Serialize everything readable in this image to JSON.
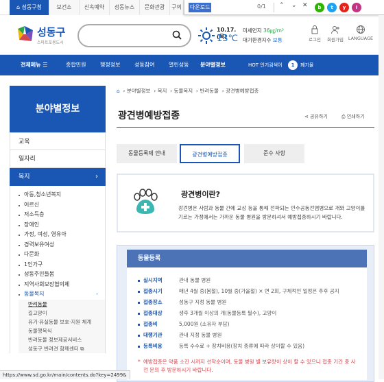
{
  "top_tabs": [
    "성동구청",
    "보건소",
    "신속예약",
    "성동뉴스",
    "문화관광",
    "구의"
  ],
  "find_bar": {
    "query": "다운로드",
    "count": "0/1"
  },
  "sns": [
    "b",
    "t",
    "y",
    "i"
  ],
  "logo": {
    "name": "성동구",
    "subtitle": "스마트포용도시"
  },
  "weather": {
    "date": "10.17.",
    "day": "목",
    "temp": "13℃"
  },
  "air": {
    "line1_label": "미세먼지",
    "line1_value": "36㎍/m³",
    "line2_label": "대기환경지수",
    "line2_value": "보통"
  },
  "utils": [
    "로그인",
    "회원가입",
    "LANGUAGE"
  ],
  "gnb": {
    "all_menu": "전체메뉴",
    "items": [
      "종합민원",
      "행정정보",
      "성동참여",
      "열린성동",
      "분야별정보"
    ],
    "hot_label": "HOT 인기검색어",
    "hot_rank": "1",
    "hot_value": "폐기물"
  },
  "lnb": {
    "title": "분야별정보",
    "menus": [
      "교육",
      "일자리",
      "복지"
    ],
    "subs": [
      "아동,청소년복지",
      "어르신",
      "저소득층",
      "장애인",
      "가정, 여성, 영유아",
      "경력보유여성",
      "다문화",
      "1인가구",
      "성동주민들봄",
      "지역사회보장협의체",
      "동물복지"
    ],
    "sub_toggle": "-",
    "sub3": [
      "반려동물",
      "길고양이",
      "유기·유실동물 보호·지원 체계",
      "동물행복식",
      "반려동물 정보제공서비스",
      "성동구 반려견 함께센터"
    ]
  },
  "breadcrumb": [
    "분야별정보",
    "복지",
    "동물복지",
    "반려동물",
    "광견병예방접종"
  ],
  "page_title": "광견병예방접종",
  "tools": {
    "share": "공유하기",
    "print": "인쇄하기"
  },
  "tabs": [
    "동물등록제 안내",
    "광견병예방접종",
    "준수 사항"
  ],
  "info": {
    "heading": "광견병이란?",
    "text": "광견병은 사람과 동물 간에 교상 등을 통해 전파되는 인수공동전염병으로 개와 고양이를 기르는 가정에서는 가까운 동물 병원을 방문하셔서 예방접종하시기 바랍니다."
  },
  "registration": {
    "header": "동물등록",
    "rows": [
      {
        "k": "실시지역",
        "v": "관내 동물 병원"
      },
      {
        "k": "접종시기",
        "v": "매년 4월 중(봄철), 10월 중(가을철) × 연 2회, 구체적인 일정은 추후 공지"
      },
      {
        "k": "접종장소",
        "v": "성동구 지정 동물 병원"
      },
      {
        "k": "접종대상",
        "v": "생후 3개월 이상의 개(동물등록 필수), 고양이"
      },
      {
        "k": "접종비",
        "v": "5,000원 (소유자 부담)"
      },
      {
        "k": "대행기관",
        "v": "관내 지정 동물 병원"
      },
      {
        "k": "등록비용",
        "v": "등록 수수료 + 장치비용(장치 종류에 따라 상이할 수 있음)"
      }
    ],
    "note": "예방접종은 약품 소진 시까지 선착순이며, 동물 병원 별 보유량이 상이 할 수 있으니 접종 기간 중 사전 문의 후 방문하시기 바랍니다."
  },
  "status_url": "https://www.sd.go.kr/main/contents.do?key=2499&"
}
